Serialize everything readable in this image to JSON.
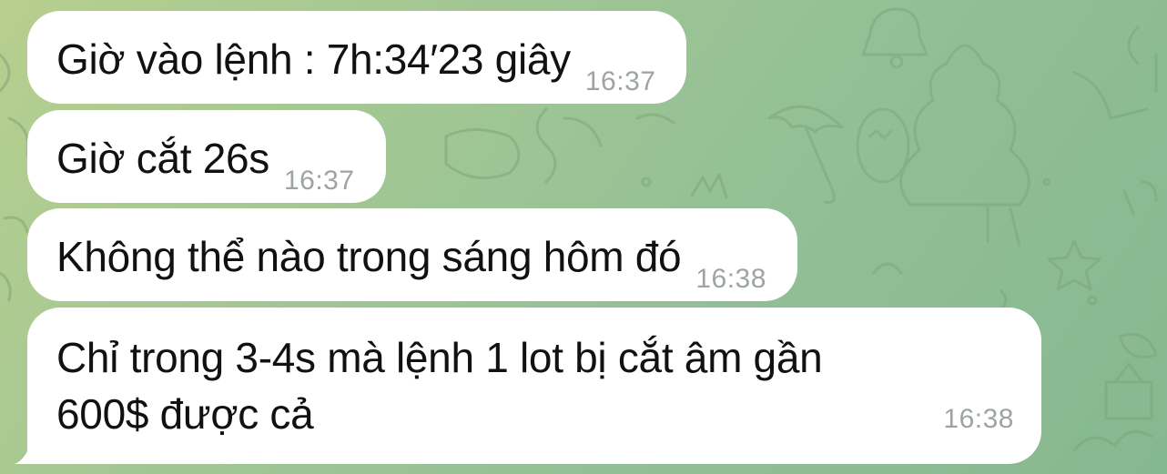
{
  "chat": {
    "messages": [
      {
        "text": "Giờ vào lệnh : 7h:34′23 giây",
        "time": "16:37"
      },
      {
        "text": "Giờ cắt 26s",
        "time": "16:37"
      },
      {
        "text": "Không thể nào trong sáng hôm đó",
        "time": "16:38"
      },
      {
        "text_line1": "Chỉ trong 3-4s mà lệnh 1 lot bị cắt âm gần",
        "text_line2": "600$ được cả",
        "time": "16:38"
      }
    ],
    "colors": {
      "bubble": "#ffffff",
      "timestamp": "#9ea3a6",
      "wallpaper_start": "#b7cf8f",
      "wallpaper_end": "#86b88f"
    },
    "wallpaper_icons": [
      "bell-icon",
      "tree-icon",
      "umbrella-icon",
      "egg-icon",
      "star-icon",
      "leaf-icon"
    ]
  }
}
